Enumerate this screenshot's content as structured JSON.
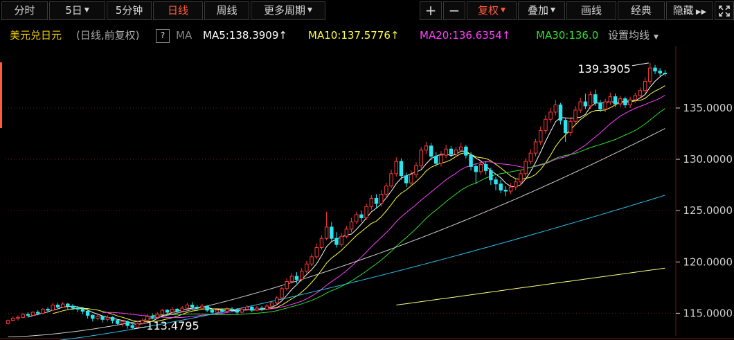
{
  "toolbar": {
    "left": [
      "分时",
      "5日",
      "5分钟",
      "日线",
      "周线",
      "更多周期"
    ],
    "active": "日线",
    "plus": "+",
    "minus": "−",
    "right": [
      "复权",
      "叠加",
      "画线",
      "经典",
      "隐藏"
    ]
  },
  "info": {
    "symbol": "美元兑日元",
    "mode": "(日线,前复权)",
    "help": "?",
    "ma_label": "MA",
    "ma5": "MA5:138.3909",
    "ma10": "MA10:137.5776",
    "ma20": "MA20:136.6354",
    "ma30": "MA30:136.0",
    "settings": "设置均线"
  },
  "colors": {
    "up": "#ff3b3b",
    "down": "#29e6f0",
    "ma5": "#ffffff",
    "ma10": "#ffff40",
    "ma20": "#ff40ff",
    "ma30": "#30e030",
    "ma60": "#cfcfcf",
    "ma120": "#2ec0ea",
    "ma250": "#ffff80",
    "axis_text": "#cfcfcf",
    "grid": "#6a1a1a"
  },
  "chart_data": {
    "type": "candlestick",
    "y_ticks": [
      "135.0000",
      "130.0000",
      "125.0000",
      "120.0000",
      "115.0000"
    ],
    "y_tick_values": [
      135,
      130,
      125,
      120,
      115
    ],
    "ylim": [
      112.8,
      140.8
    ],
    "annotations": [
      {
        "text": "139.3905",
        "value": 139.3905,
        "label": "high"
      },
      {
        "text": "113.4795",
        "value": 113.4795,
        "label": "low"
      }
    ],
    "candles": [
      [
        114.0,
        114.3,
        113.9,
        114.4
      ],
      [
        114.3,
        114.5,
        114.2,
        114.7
      ],
      [
        114.5,
        114.6,
        114.3,
        114.8
      ],
      [
        114.6,
        114.9,
        114.5,
        115.0
      ],
      [
        114.9,
        114.8,
        114.6,
        115.1
      ],
      [
        114.8,
        115.1,
        114.7,
        115.2
      ],
      [
        115.1,
        115.0,
        114.8,
        115.3
      ],
      [
        115.0,
        115.4,
        114.9,
        115.5
      ],
      [
        115.4,
        115.3,
        115.1,
        115.6
      ],
      [
        115.3,
        115.8,
        115.2,
        116.0
      ],
      [
        115.8,
        115.6,
        115.4,
        116.0
      ],
      [
        115.6,
        115.9,
        115.5,
        116.1
      ],
      [
        115.9,
        115.7,
        115.4,
        116.0
      ],
      [
        115.7,
        115.5,
        115.3,
        115.9
      ],
      [
        115.5,
        115.4,
        115.1,
        115.7
      ],
      [
        115.4,
        115.2,
        114.9,
        115.6
      ],
      [
        115.2,
        114.8,
        114.5,
        115.3
      ],
      [
        114.8,
        114.5,
        114.2,
        114.9
      ],
      [
        114.5,
        114.7,
        114.3,
        114.9
      ],
      [
        114.7,
        114.4,
        114.1,
        114.8
      ],
      [
        114.4,
        114.6,
        114.2,
        114.8
      ],
      [
        114.6,
        114.3,
        114.0,
        114.7
      ],
      [
        114.3,
        114.0,
        113.8,
        114.4
      ],
      [
        114.0,
        114.2,
        113.7,
        114.3
      ],
      [
        114.2,
        113.8,
        113.5,
        114.3
      ],
      [
        113.8,
        113.6,
        113.4795,
        114.0
      ],
      [
        113.6,
        114.0,
        113.5,
        114.1
      ],
      [
        114.0,
        114.3,
        113.9,
        114.5
      ],
      [
        114.3,
        114.7,
        114.2,
        114.9
      ],
      [
        114.7,
        114.6,
        114.4,
        115.0
      ],
      [
        114.6,
        114.9,
        114.5,
        115.1
      ],
      [
        114.9,
        115.3,
        114.8,
        115.4
      ],
      [
        115.3,
        115.1,
        114.9,
        115.4
      ],
      [
        115.1,
        115.4,
        115.0,
        115.6
      ],
      [
        115.4,
        115.2,
        115.0,
        115.5
      ],
      [
        115.2,
        115.5,
        115.1,
        115.7
      ],
      [
        115.5,
        115.8,
        115.4,
        116.0
      ],
      [
        115.8,
        115.6,
        115.4,
        116.1
      ],
      [
        115.6,
        115.5,
        115.3,
        115.8
      ],
      [
        115.5,
        115.7,
        115.4,
        115.9
      ],
      [
        115.7,
        115.3,
        115.1,
        115.8
      ],
      [
        115.3,
        115.1,
        114.9,
        115.4
      ],
      [
        115.1,
        115.3,
        115.0,
        115.5
      ],
      [
        115.3,
        115.2,
        115.0,
        115.5
      ],
      [
        115.2,
        115.4,
        115.1,
        115.6
      ],
      [
        115.4,
        115.3,
        115.1,
        115.6
      ],
      [
        115.3,
        115.1,
        114.9,
        115.5
      ],
      [
        115.1,
        115.4,
        115.0,
        115.6
      ],
      [
        115.4,
        115.6,
        115.3,
        115.8
      ],
      [
        115.6,
        115.3,
        115.1,
        115.7
      ],
      [
        115.3,
        115.5,
        115.2,
        115.7
      ],
      [
        115.5,
        115.4,
        115.2,
        115.7
      ],
      [
        115.4,
        115.7,
        115.3,
        115.9
      ],
      [
        115.7,
        116.0,
        115.6,
        116.2
      ],
      [
        116.0,
        116.5,
        115.9,
        116.7
      ],
      [
        116.5,
        117.4,
        116.4,
        117.6
      ],
      [
        117.4,
        118.1,
        117.2,
        118.4
      ],
      [
        118.1,
        118.6,
        117.9,
        118.9
      ],
      [
        118.6,
        118.3,
        117.9,
        119.0
      ],
      [
        118.3,
        119.1,
        118.1,
        119.4
      ],
      [
        119.1,
        119.8,
        118.9,
        120.1
      ],
      [
        119.8,
        120.5,
        119.6,
        120.8
      ],
      [
        120.5,
        121.4,
        120.3,
        121.8
      ],
      [
        121.4,
        122.3,
        121.2,
        122.6
      ],
      [
        122.3,
        123.4,
        122.1,
        124.9
      ],
      [
        123.4,
        122.3,
        121.9,
        123.9
      ],
      [
        122.3,
        121.7,
        121.4,
        122.9
      ],
      [
        121.7,
        122.5,
        121.5,
        122.8
      ],
      [
        122.5,
        123.2,
        122.3,
        123.5
      ],
      [
        123.2,
        123.9,
        122.9,
        124.3
      ],
      [
        123.9,
        124.6,
        123.7,
        124.9
      ],
      [
        124.6,
        124.3,
        123.9,
        125.0
      ],
      [
        124.3,
        125.4,
        124.1,
        125.7
      ],
      [
        125.4,
        126.2,
        125.1,
        126.5
      ],
      [
        126.2,
        125.7,
        125.3,
        126.6
      ],
      [
        125.7,
        126.6,
        125.4,
        127.0
      ],
      [
        126.6,
        127.4,
        126.3,
        127.7
      ],
      [
        127.4,
        128.6,
        127.2,
        129.0
      ],
      [
        128.6,
        129.8,
        128.3,
        130.2
      ],
      [
        129.8,
        128.4,
        128.0,
        130.1
      ],
      [
        128.4,
        127.7,
        127.3,
        128.7
      ],
      [
        127.7,
        128.5,
        127.4,
        128.9
      ],
      [
        128.5,
        129.4,
        128.2,
        129.7
      ],
      [
        129.4,
        130.9,
        129.1,
        131.2
      ],
      [
        130.9,
        131.3,
        130.5,
        131.7
      ],
      [
        131.3,
        130.3,
        129.9,
        131.6
      ],
      [
        130.3,
        129.6,
        129.3,
        130.7
      ],
      [
        129.6,
        130.4,
        129.3,
        130.8
      ],
      [
        130.4,
        131.0,
        130.1,
        131.4
      ],
      [
        131.0,
        130.5,
        130.2,
        131.3
      ],
      [
        130.5,
        130.9,
        130.2,
        131.2
      ],
      [
        130.9,
        131.2,
        130.7,
        131.6
      ],
      [
        131.2,
        130.4,
        130.1,
        131.4
      ],
      [
        130.4,
        129.3,
        128.9,
        130.7
      ],
      [
        129.3,
        128.8,
        127.6,
        129.6
      ],
      [
        128.8,
        129.5,
        128.5,
        129.8
      ],
      [
        129.5,
        128.9,
        128.5,
        129.8
      ],
      [
        128.9,
        128.0,
        127.5,
        129.2
      ],
      [
        128.0,
        127.6,
        127.0,
        128.3
      ],
      [
        127.6,
        127.0,
        126.7,
        128.0
      ],
      [
        127.0,
        126.9,
        126.4,
        127.4
      ],
      [
        126.9,
        127.3,
        126.6,
        127.7
      ],
      [
        127.3,
        127.8,
        127.0,
        128.1
      ],
      [
        127.8,
        128.6,
        127.5,
        128.9
      ],
      [
        128.6,
        129.8,
        128.3,
        130.1
      ],
      [
        129.8,
        130.6,
        129.5,
        131.0
      ],
      [
        130.6,
        131.7,
        130.3,
        132.0
      ],
      [
        131.7,
        132.8,
        131.4,
        133.2
      ],
      [
        132.8,
        133.9,
        132.5,
        134.3
      ],
      [
        133.9,
        134.6,
        133.6,
        135.0
      ],
      [
        134.6,
        135.3,
        134.3,
        135.8
      ],
      [
        135.3,
        133.8,
        133.4,
        135.5
      ],
      [
        133.8,
        132.6,
        131.7,
        134.0
      ],
      [
        132.6,
        133.7,
        132.3,
        134.1
      ],
      [
        133.7,
        134.8,
        133.4,
        135.2
      ],
      [
        134.8,
        135.6,
        134.5,
        136.0
      ],
      [
        135.6,
        135.2,
        134.9,
        136.4
      ],
      [
        135.2,
        136.3,
        134.9,
        136.6
      ],
      [
        136.3,
        135.5,
        135.2,
        136.8
      ],
      [
        135.5,
        134.9,
        134.6,
        135.8
      ],
      [
        134.9,
        135.6,
        134.6,
        135.9
      ],
      [
        135.6,
        136.1,
        135.3,
        136.5
      ],
      [
        136.1,
        135.4,
        135.1,
        136.4
      ],
      [
        135.4,
        135.9,
        135.1,
        136.2
      ],
      [
        135.9,
        135.3,
        135.0,
        136.1
      ],
      [
        135.3,
        135.8,
        135.0,
        136.1
      ],
      [
        135.8,
        136.2,
        135.5,
        136.5
      ],
      [
        136.2,
        136.7,
        135.9,
        137.0
      ],
      [
        136.7,
        137.6,
        136.4,
        138.0
      ],
      [
        137.6,
        138.9,
        137.3,
        139.3905
      ],
      [
        138.9,
        138.6,
        138.3,
        139.2
      ],
      [
        138.6,
        138.4,
        138.1,
        138.9
      ],
      [
        138.4,
        138.3909,
        138.1,
        138.7
      ]
    ],
    "ma_lines": [
      {
        "name": "MA5",
        "start": 4
      },
      {
        "name": "MA10",
        "start": 9
      },
      {
        "name": "MA20",
        "start": 19
      },
      {
        "name": "MA30",
        "start": 29
      },
      {
        "name": "MA60",
        "start": 0
      },
      {
        "name": "MA120",
        "start": 0
      },
      {
        "name": "MA250",
        "start": 78
      }
    ]
  }
}
